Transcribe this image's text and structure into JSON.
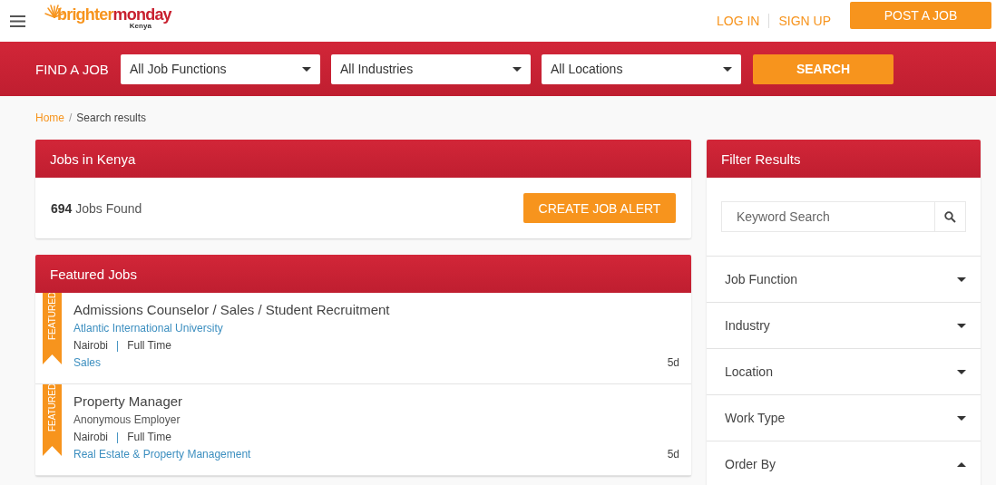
{
  "header": {
    "logo": {
      "brand_first": "brighter",
      "brand_second": "monday",
      "country": "Kenya"
    },
    "links": [
      "LOG IN",
      "SIGN UP"
    ],
    "post_button": "POST A JOB"
  },
  "search_bar": {
    "label": "FIND A JOB",
    "selects": [
      "All Job Functions",
      "All Industries",
      "All Locations"
    ],
    "button": "SEARCH"
  },
  "breadcrumb": {
    "separator": "/",
    "items": [
      {
        "label": "Home",
        "link": true
      },
      {
        "label": "Search results",
        "link": false
      }
    ]
  },
  "results": {
    "title": "Jobs in Kenya",
    "count": "694",
    "count_label": "Jobs Found",
    "alert_button": "CREATE JOB ALERT"
  },
  "featured": {
    "title": "Featured Jobs",
    "jobs": [
      {
        "ribbon": "FEATURED",
        "title": "Admissions Counselor / Sales / Student Recruitment",
        "employer": "Atlantic International University",
        "employer_link": true,
        "location": "Nairobi",
        "separator": "|",
        "type": "Full Time",
        "category": "Sales",
        "age": "5d"
      },
      {
        "ribbon": "FEATURED",
        "title": "Property Manager",
        "employer": "Anonymous Employer",
        "employer_link": false,
        "location": "Nairobi",
        "separator": "|",
        "type": "Full Time",
        "category": "Real Estate & Property Management",
        "age": "5d"
      }
    ]
  },
  "filters": {
    "title": "Filter Results",
    "search_placeholder": "Keyword Search",
    "sections": [
      {
        "label": "Job Function",
        "expanded": false
      },
      {
        "label": "Industry",
        "expanded": false
      },
      {
        "label": "Location",
        "expanded": false
      },
      {
        "label": "Work Type",
        "expanded": false
      },
      {
        "label": "Order By",
        "expanded": true
      }
    ]
  }
}
